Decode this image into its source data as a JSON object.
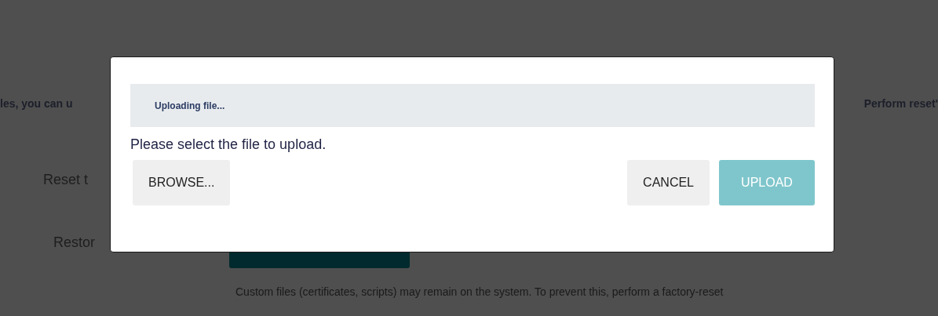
{
  "background_page": {
    "intro_fragment": "les, you can u",
    "intro_fragment_right": "Perform reset'",
    "rows": [
      {
        "label": "Reset t"
      },
      {
        "label": "Restor"
      }
    ],
    "note": "Custom files (certificates, scripts) may remain on the system. To prevent this, perform a factory-reset"
  },
  "dialog": {
    "status": "Uploading file...",
    "message": "Please select the file to upload.",
    "buttons": [
      {
        "label": "BROWSE...",
        "kind": "secondary",
        "disabled": false
      },
      {
        "label": "CANCEL",
        "kind": "secondary",
        "disabled": false
      },
      {
        "label": "UPLOAD",
        "kind": "primary",
        "disabled": true
      }
    ]
  }
}
